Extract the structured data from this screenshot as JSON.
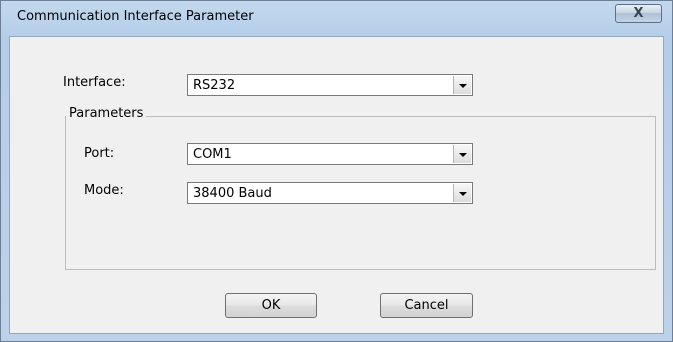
{
  "window": {
    "title": "Communication Interface Parameter",
    "close_glyph": "X",
    "close_icon": "close-icon"
  },
  "form": {
    "interface_label": "Interface:",
    "interface_value": "RS232",
    "parameters_title": "Parameters",
    "port_label": "Port:",
    "port_value": "COM1",
    "mode_label": "Mode:",
    "mode_value": "38400 Baud"
  },
  "buttons": {
    "ok": "OK",
    "cancel": "Cancel"
  },
  "colors": {
    "title_bar": "#b4cde8",
    "dialog_bg": "#f0f0f0"
  }
}
